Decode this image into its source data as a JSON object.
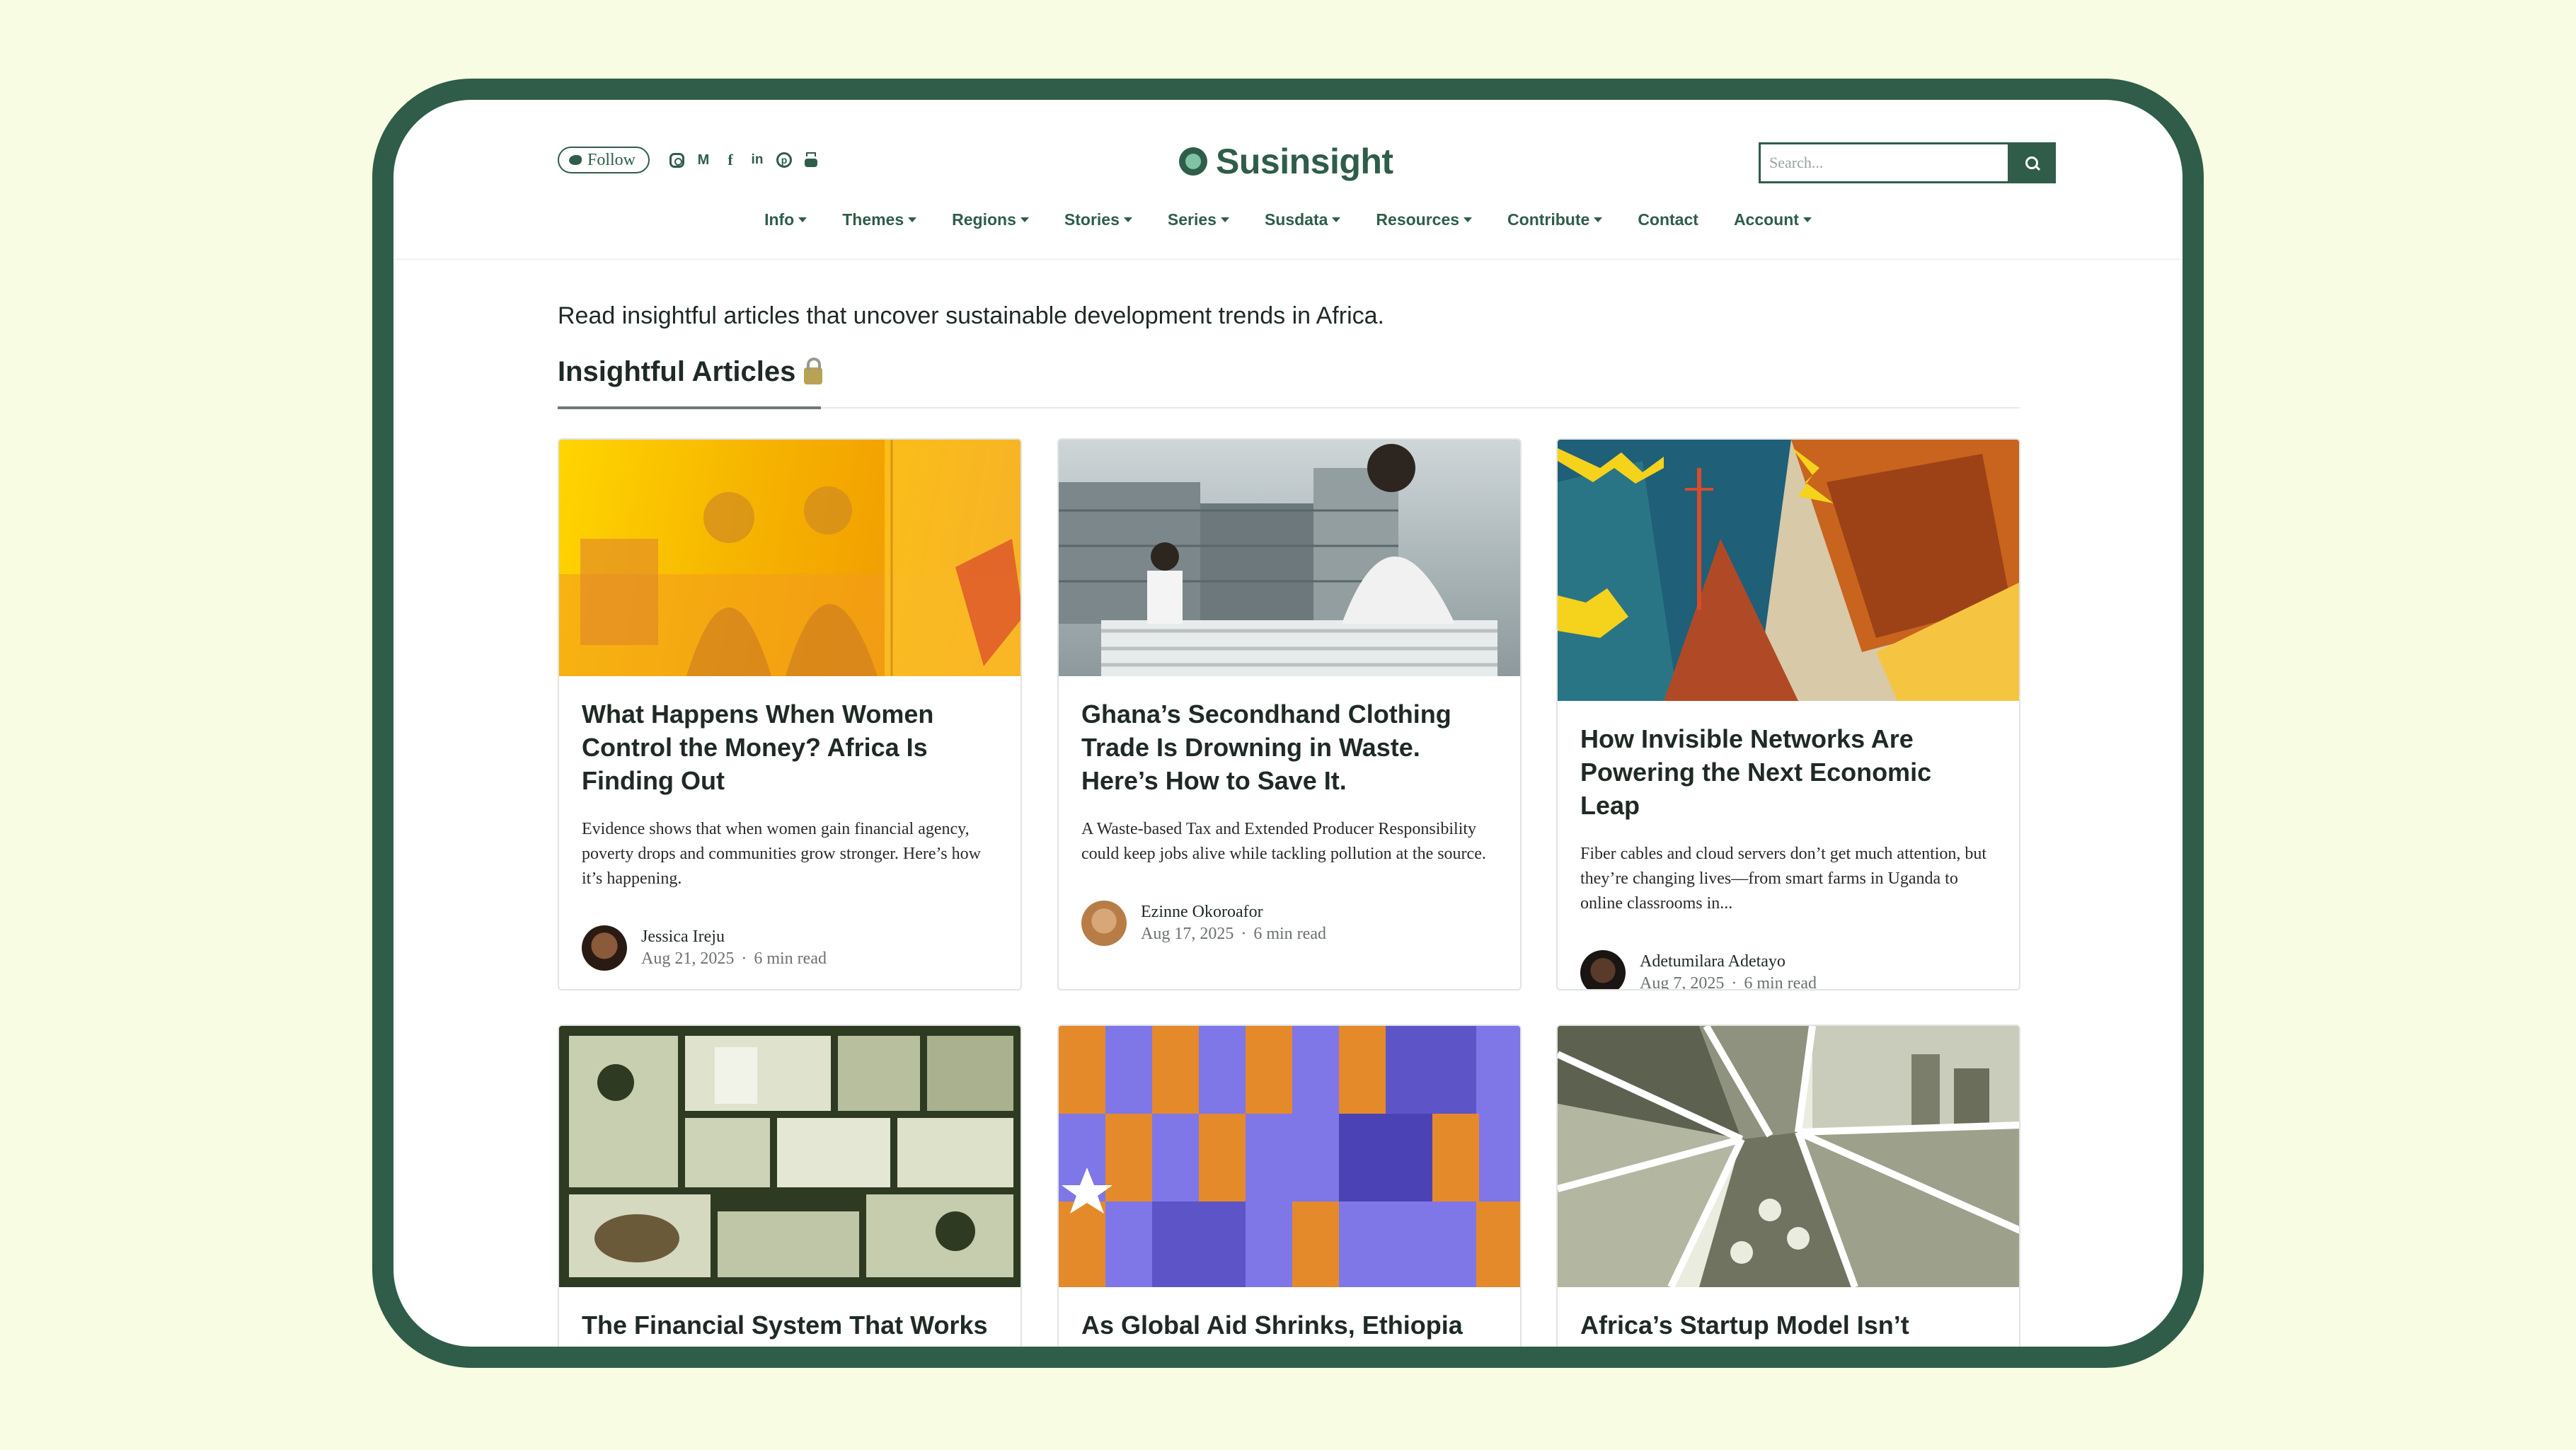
{
  "header": {
    "follow_label": "Follow",
    "socials": [
      "instagram-icon",
      "medium-icon",
      "facebook-icon",
      "linkedin-icon",
      "pinterest-icon",
      "youtube-icon"
    ],
    "logo_text": "Susinsight",
    "search_placeholder": "Search..."
  },
  "nav": {
    "items": [
      {
        "label": "Info",
        "dropdown": true
      },
      {
        "label": "Themes",
        "dropdown": true
      },
      {
        "label": "Regions",
        "dropdown": true
      },
      {
        "label": "Stories",
        "dropdown": true
      },
      {
        "label": "Series",
        "dropdown": true
      },
      {
        "label": "Susdata",
        "dropdown": true
      },
      {
        "label": "Resources",
        "dropdown": true
      },
      {
        "label": "Contribute",
        "dropdown": true
      },
      {
        "label": "Contact",
        "dropdown": false
      },
      {
        "label": "Account",
        "dropdown": true
      }
    ]
  },
  "main": {
    "intro": "Read insightful articles that uncover sustainable development trends in Africa.",
    "section_title": "Insightful Articles"
  },
  "articles": [
    {
      "title": "What Happens When Women Control the Money? Africa Is Finding Out",
      "excerpt": "Evidence shows that when women gain financial agency, poverty drops and communities grow stronger. Here’s how it’s happening.",
      "author": "Jessica Ireju",
      "date": "Aug 21, 2025",
      "read_time": "6 min read"
    },
    {
      "title": "Ghana’s Secondhand Clothing Trade Is Drowning in Waste. Here’s How to Save It.",
      "excerpt": "A Waste-based Tax and Extended Producer Responsibility could keep jobs alive while tackling pollution at the source.",
      "author": "Ezinne Okoroafor",
      "date": "Aug 17, 2025",
      "read_time": "6 min read"
    },
    {
      "title": "How Invisible Networks Are Powering the Next Economic Leap",
      "excerpt": "Fiber cables and cloud servers don’t get much attention, but they’re changing lives—from smart farms in Uganda to online classrooms in...",
      "author": "Adetumilara Adetayo",
      "date": "Aug 7, 2025",
      "read_time": "6 min read"
    },
    {
      "title": "The Financial System That Works Without Banks"
    },
    {
      "title": "As Global Aid Shrinks, Ethiopia and Somalia Fight to Keep"
    },
    {
      "title": "Africa’s Startup Model Isn’t Broken. It Was Built for the Wrong"
    }
  ],
  "colors": {
    "page_bg": "#f8fce3",
    "brand": "#2f5d4a",
    "frame": "#2f5d4a"
  }
}
